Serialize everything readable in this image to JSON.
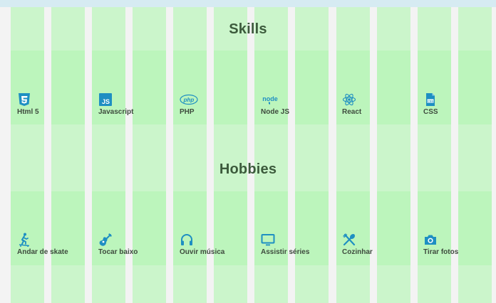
{
  "skills": {
    "title": "Skills",
    "items": [
      {
        "label": "Html 5",
        "icon": "html5-icon"
      },
      {
        "label": "Javascript",
        "icon": "js-icon"
      },
      {
        "label": "PHP",
        "icon": "php-icon"
      },
      {
        "label": "Node JS",
        "icon": "nodejs-icon"
      },
      {
        "label": "React",
        "icon": "react-icon"
      },
      {
        "label": "CSS",
        "icon": "css-file-icon"
      }
    ]
  },
  "hobbies": {
    "title": "Hobbies",
    "items": [
      {
        "label": "Andar de skate",
        "icon": "skateboard-icon"
      },
      {
        "label": "Tocar baixo",
        "icon": "guitar-icon"
      },
      {
        "label": "Ouvir música",
        "icon": "headphones-icon"
      },
      {
        "label": "Assistir séries",
        "icon": "tv-icon"
      },
      {
        "label": "Cozinhar",
        "icon": "utensils-icon"
      },
      {
        "label": "Tirar fotos",
        "icon": "camera-icon"
      }
    ]
  },
  "colors": {
    "icon": "#1e8fc2",
    "title": "#3c5a3c",
    "grid_overlay": "#b8f5b8",
    "background": "#f3f3f3"
  }
}
